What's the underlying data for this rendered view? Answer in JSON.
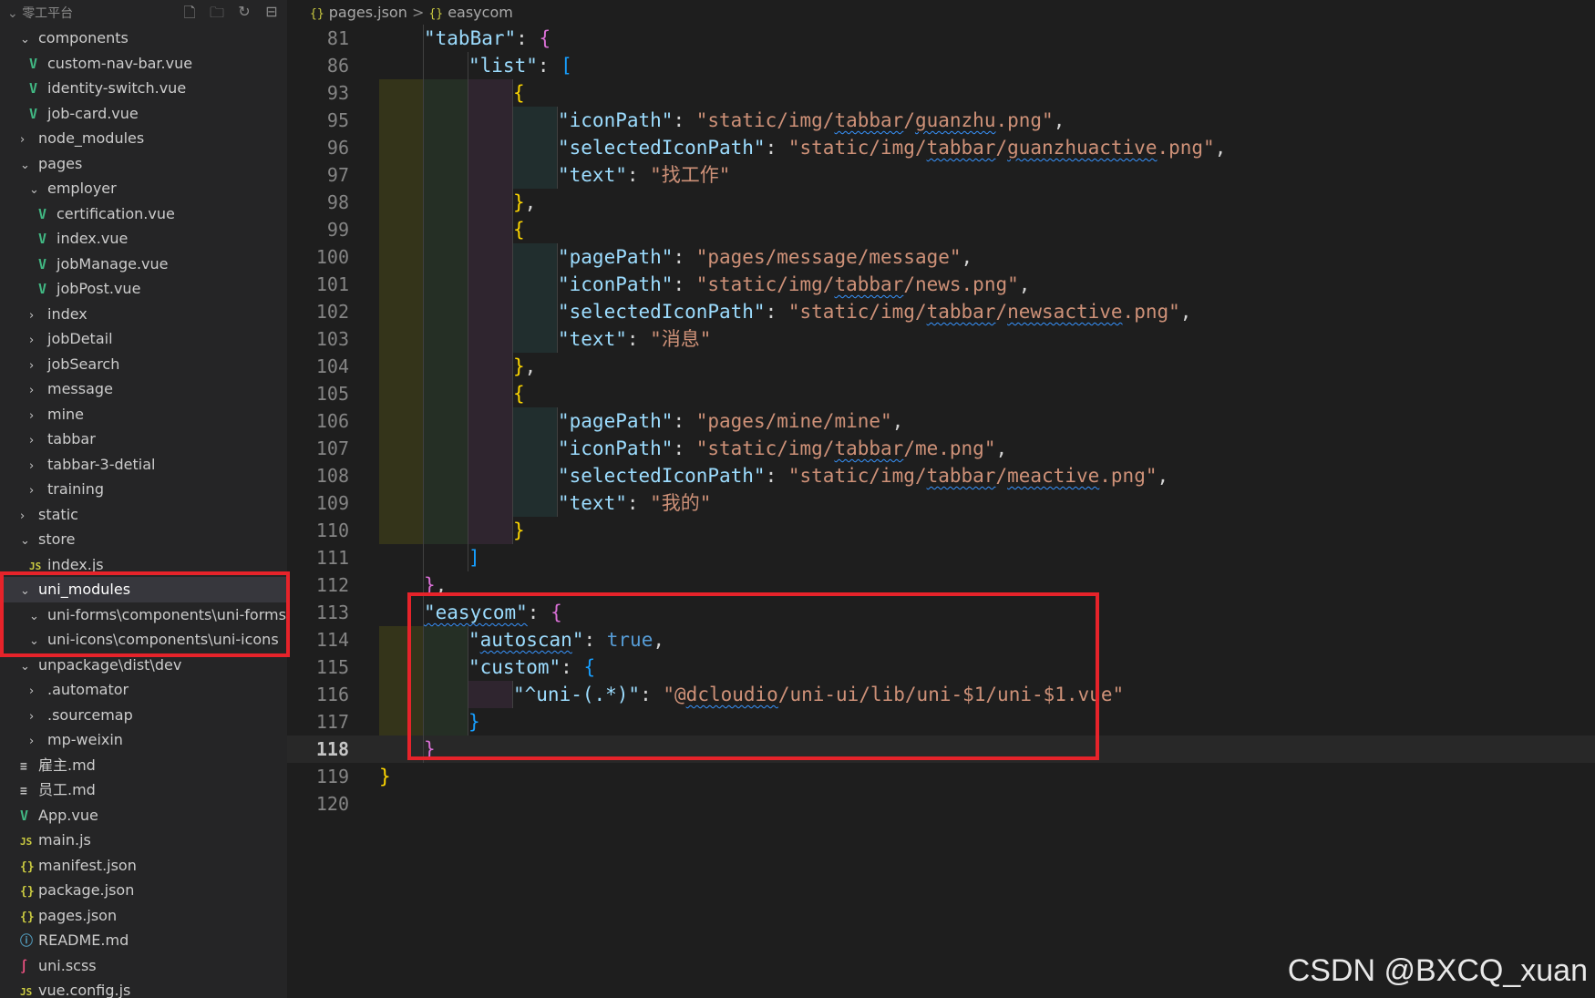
{
  "explorer": {
    "title": "零工平台",
    "actions": [
      {
        "name": "new-file-icon",
        "glyph": "🗋"
      },
      {
        "name": "new-folder-icon",
        "glyph": "🗀"
      },
      {
        "name": "refresh-icon",
        "glyph": "↻"
      },
      {
        "name": "collapse-all-icon",
        "glyph": "⊟"
      }
    ],
    "items": [
      {
        "label": "components",
        "depth": 1,
        "type": "folder-open"
      },
      {
        "label": "custom-nav-bar.vue",
        "depth": 2,
        "type": "vue"
      },
      {
        "label": "identity-switch.vue",
        "depth": 2,
        "type": "vue"
      },
      {
        "label": "job-card.vue",
        "depth": 2,
        "type": "vue"
      },
      {
        "label": "node_modules",
        "depth": 1,
        "type": "folder-closed"
      },
      {
        "label": "pages",
        "depth": 1,
        "type": "folder-open"
      },
      {
        "label": "employer",
        "depth": 2,
        "type": "folder-open"
      },
      {
        "label": "certification.vue",
        "depth": 3,
        "type": "vue"
      },
      {
        "label": "index.vue",
        "depth": 3,
        "type": "vue"
      },
      {
        "label": "jobManage.vue",
        "depth": 3,
        "type": "vue"
      },
      {
        "label": "jobPost.vue",
        "depth": 3,
        "type": "vue"
      },
      {
        "label": "index",
        "depth": 2,
        "type": "folder-closed"
      },
      {
        "label": "jobDetail",
        "depth": 2,
        "type": "folder-closed"
      },
      {
        "label": "jobSearch",
        "depth": 2,
        "type": "folder-closed"
      },
      {
        "label": "message",
        "depth": 2,
        "type": "folder-closed"
      },
      {
        "label": "mine",
        "depth": 2,
        "type": "folder-closed"
      },
      {
        "label": "tabbar",
        "depth": 2,
        "type": "folder-closed"
      },
      {
        "label": "tabbar-3-detial",
        "depth": 2,
        "type": "folder-closed"
      },
      {
        "label": "training",
        "depth": 2,
        "type": "folder-closed"
      },
      {
        "label": "static",
        "depth": 1,
        "type": "folder-closed"
      },
      {
        "label": "store",
        "depth": 1,
        "type": "folder-open"
      },
      {
        "label": "index.js",
        "depth": 2,
        "type": "js"
      },
      {
        "label": "uni_modules",
        "depth": 1,
        "type": "folder-open",
        "selected": true
      },
      {
        "label": "uni-forms\\components\\uni-forms",
        "depth": 2,
        "type": "folder-open"
      },
      {
        "label": "uni-icons\\components\\uni-icons",
        "depth": 2,
        "type": "folder-open"
      },
      {
        "label": "unpackage\\dist\\dev",
        "depth": 1,
        "type": "folder-open"
      },
      {
        "label": ".automator",
        "depth": 2,
        "type": "folder-closed"
      },
      {
        "label": ".sourcemap",
        "depth": 2,
        "type": "folder-closed"
      },
      {
        "label": "mp-weixin",
        "depth": 2,
        "type": "folder-closed"
      },
      {
        "label": "雇主.md",
        "depth": 1,
        "type": "md"
      },
      {
        "label": "员工.md",
        "depth": 1,
        "type": "md"
      },
      {
        "label": "App.vue",
        "depth": 1,
        "type": "vue"
      },
      {
        "label": "main.js",
        "depth": 1,
        "type": "js"
      },
      {
        "label": "manifest.json",
        "depth": 1,
        "type": "json"
      },
      {
        "label": "package.json",
        "depth": 1,
        "type": "json"
      },
      {
        "label": "pages.json",
        "depth": 1,
        "type": "json"
      },
      {
        "label": "README.md",
        "depth": 1,
        "type": "info"
      },
      {
        "label": "uni.scss",
        "depth": 1,
        "type": "scss"
      },
      {
        "label": "vue.config.js",
        "depth": 1,
        "type": "js"
      }
    ]
  },
  "breadcrumb": {
    "file_icon": "{}",
    "file": "pages.json",
    "separator": ">",
    "symbol_icon": "{}",
    "symbol": "easycom"
  },
  "editor": {
    "current_line": "118",
    "lines": [
      {
        "n": "81",
        "indent": 1,
        "tokens": [
          [
            "k",
            "\"tabBar\""
          ],
          [
            "p",
            ": "
          ],
          [
            "b2",
            "{"
          ]
        ]
      },
      {
        "n": "86",
        "indent": 2,
        "tokens": [
          [
            "k",
            "\"list\""
          ],
          [
            "p",
            ": "
          ],
          [
            "b3",
            "["
          ]
        ]
      },
      {
        "n": "93",
        "indent": 3,
        "tokens": [
          [
            "b1",
            "{"
          ]
        ]
      },
      {
        "n": "95",
        "indent": 4,
        "tokens": [
          [
            "k",
            "\"iconPath\""
          ],
          [
            "p",
            ": "
          ],
          [
            "s",
            "\"static/img/"
          ],
          [
            "sw",
            "tabbar"
          ],
          [
            "s",
            "/"
          ],
          [
            "sw",
            "guanzhu"
          ],
          [
            "s",
            ".png\""
          ],
          [
            "p",
            ","
          ]
        ]
      },
      {
        "n": "96",
        "indent": 4,
        "tokens": [
          [
            "k",
            "\"selectedIconPath\""
          ],
          [
            "p",
            ": "
          ],
          [
            "s",
            "\"static/img/"
          ],
          [
            "sw",
            "tabbar"
          ],
          [
            "s",
            "/"
          ],
          [
            "sw",
            "guanzhuactive"
          ],
          [
            "s",
            ".png\""
          ],
          [
            "p",
            ","
          ]
        ]
      },
      {
        "n": "97",
        "indent": 4,
        "tokens": [
          [
            "k",
            "\"text\""
          ],
          [
            "p",
            ": "
          ],
          [
            "s",
            "\"找工作\""
          ]
        ]
      },
      {
        "n": "98",
        "indent": 3,
        "tokens": [
          [
            "b1",
            "}"
          ],
          [
            "p",
            ","
          ]
        ]
      },
      {
        "n": "99",
        "indent": 3,
        "tokens": [
          [
            "b1",
            "{"
          ]
        ]
      },
      {
        "n": "100",
        "indent": 4,
        "tokens": [
          [
            "k",
            "\"pagePath\""
          ],
          [
            "p",
            ": "
          ],
          [
            "s",
            "\"pages/message/message\""
          ],
          [
            "p",
            ","
          ]
        ]
      },
      {
        "n": "101",
        "indent": 4,
        "tokens": [
          [
            "k",
            "\"iconPath\""
          ],
          [
            "p",
            ": "
          ],
          [
            "s",
            "\"static/img/"
          ],
          [
            "sw",
            "tabbar"
          ],
          [
            "s",
            "/news.png\""
          ],
          [
            "p",
            ","
          ]
        ]
      },
      {
        "n": "102",
        "indent": 4,
        "tokens": [
          [
            "k",
            "\"selectedIconPath\""
          ],
          [
            "p",
            ": "
          ],
          [
            "s",
            "\"static/img/"
          ],
          [
            "sw",
            "tabbar"
          ],
          [
            "s",
            "/"
          ],
          [
            "sw",
            "newsactive"
          ],
          [
            "s",
            ".png\""
          ],
          [
            "p",
            ","
          ]
        ]
      },
      {
        "n": "103",
        "indent": 4,
        "tokens": [
          [
            "k",
            "\"text\""
          ],
          [
            "p",
            ": "
          ],
          [
            "s",
            "\"消息\""
          ]
        ]
      },
      {
        "n": "104",
        "indent": 3,
        "tokens": [
          [
            "b1",
            "}"
          ],
          [
            "p",
            ","
          ]
        ]
      },
      {
        "n": "105",
        "indent": 3,
        "tokens": [
          [
            "b1",
            "{"
          ]
        ]
      },
      {
        "n": "106",
        "indent": 4,
        "tokens": [
          [
            "k",
            "\"pagePath\""
          ],
          [
            "p",
            ": "
          ],
          [
            "s",
            "\"pages/mine/mine\""
          ],
          [
            "p",
            ","
          ]
        ]
      },
      {
        "n": "107",
        "indent": 4,
        "tokens": [
          [
            "k",
            "\"iconPath\""
          ],
          [
            "p",
            ": "
          ],
          [
            "s",
            "\"static/img/"
          ],
          [
            "sw",
            "tabbar"
          ],
          [
            "s",
            "/me.png\""
          ],
          [
            "p",
            ","
          ]
        ]
      },
      {
        "n": "108",
        "indent": 4,
        "tokens": [
          [
            "k",
            "\"selectedIconPath\""
          ],
          [
            "p",
            ": "
          ],
          [
            "s",
            "\"static/img/"
          ],
          [
            "sw",
            "tabbar"
          ],
          [
            "s",
            "/"
          ],
          [
            "sw",
            "meactive"
          ],
          [
            "s",
            ".png\""
          ],
          [
            "p",
            ","
          ]
        ]
      },
      {
        "n": "109",
        "indent": 4,
        "tokens": [
          [
            "k",
            "\"text\""
          ],
          [
            "p",
            ": "
          ],
          [
            "s",
            "\"我的\""
          ]
        ]
      },
      {
        "n": "110",
        "indent": 3,
        "tokens": [
          [
            "b1",
            "}"
          ]
        ]
      },
      {
        "n": "111",
        "indent": 2,
        "tokens": [
          [
            "b3",
            "]"
          ]
        ]
      },
      {
        "n": "112",
        "indent": 1,
        "tokens": [
          [
            "b2",
            "}"
          ],
          [
            "p",
            ","
          ]
        ]
      },
      {
        "n": "113",
        "indent": 1,
        "tokens": [
          [
            "kw_w",
            "\"easycom\""
          ],
          [
            "p",
            ": "
          ],
          [
            "b2",
            "{"
          ]
        ]
      },
      {
        "n": "114",
        "indent": 2,
        "tokens": [
          [
            "k",
            "\""
          ],
          [
            "kw_w2",
            "autoscan"
          ],
          [
            "k",
            "\""
          ],
          [
            "p",
            ": "
          ],
          [
            "kw",
            "true"
          ],
          [
            "p",
            ","
          ]
        ]
      },
      {
        "n": "115",
        "indent": 2,
        "tokens": [
          [
            "k",
            "\"custom\""
          ],
          [
            "p",
            ": "
          ],
          [
            "b3",
            "{"
          ]
        ]
      },
      {
        "n": "116",
        "indent": 3,
        "tokens": [
          [
            "k",
            "\"^uni-(.*)\""
          ],
          [
            "p",
            ": "
          ],
          [
            "s",
            "\"@"
          ],
          [
            "sw",
            "dcloudio"
          ],
          [
            "s",
            "/uni-ui/lib/uni-$1/uni-$1.vue\""
          ]
        ]
      },
      {
        "n": "117",
        "indent": 2,
        "tokens": [
          [
            "b3",
            "}"
          ]
        ]
      },
      {
        "n": "118",
        "indent": 1,
        "tokens": [
          [
            "b2",
            "}"
          ]
        ]
      },
      {
        "n": "119",
        "indent": 0,
        "tokens": [
          [
            "b1",
            "}"
          ]
        ]
      },
      {
        "n": "120",
        "indent": 0,
        "tokens": []
      }
    ]
  },
  "watermark": "CSDN @BXCQ_xuan"
}
